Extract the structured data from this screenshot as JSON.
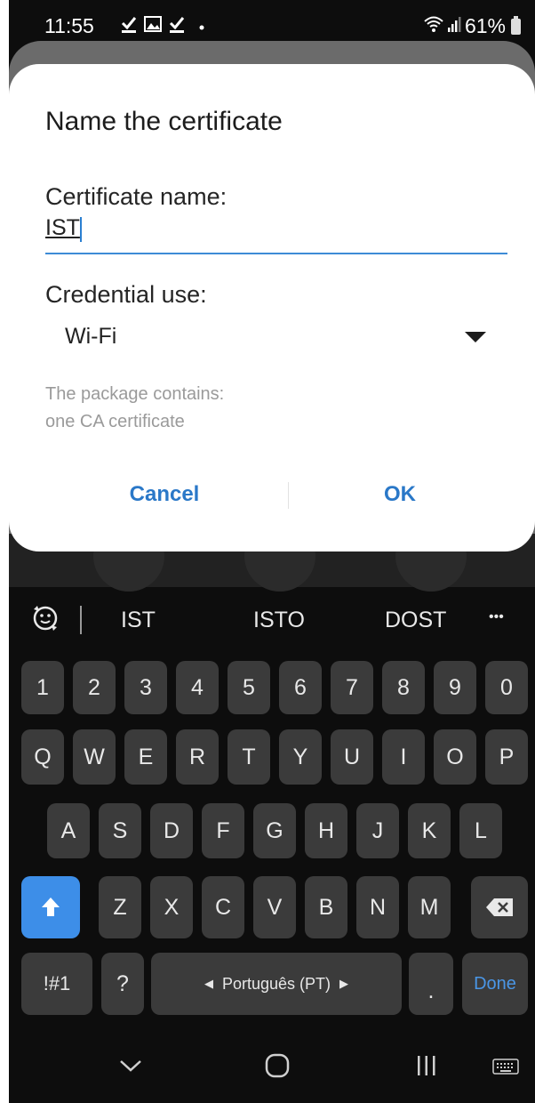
{
  "status_bar": {
    "time": "11:55",
    "notification_icons": [
      "download-done-icon",
      "image-icon",
      "download-done-icon",
      "dot-icon"
    ],
    "battery_percent": "61%",
    "signal_icons": [
      "wifi-icon",
      "signal-icon",
      "battery-icon"
    ]
  },
  "dialog": {
    "title": "Name the certificate",
    "certificate_name_label": "Certificate name:",
    "certificate_name_value": "IST",
    "credential_use_label": "Credential use:",
    "credential_use_value": "Wi-Fi",
    "info_line1": "The package contains:",
    "info_line2": "one CA certificate",
    "cancel_label": "Cancel",
    "ok_label": "OK",
    "accent_color": "#2a78c8"
  },
  "keyboard": {
    "suggestions": [
      "IST",
      "ISTO",
      "DOST"
    ],
    "more_label": "•••",
    "row_numbers": [
      "1",
      "2",
      "3",
      "4",
      "5",
      "6",
      "7",
      "8",
      "9",
      "0"
    ],
    "row_top": [
      "Q",
      "W",
      "E",
      "R",
      "T",
      "Y",
      "U",
      "I",
      "O",
      "P"
    ],
    "row_middle": [
      "A",
      "S",
      "D",
      "F",
      "G",
      "H",
      "J",
      "K",
      "L"
    ],
    "row_bottom": [
      "Z",
      "X",
      "C",
      "V",
      "B",
      "N",
      "M"
    ],
    "symbols_label": "!#1",
    "question_label": "?",
    "space_label": "Português (PT)",
    "period_label": ".",
    "done_label": "Done",
    "shift_color": "#3d8ee8"
  },
  "nav_bar": {
    "buttons": [
      "hide-keyboard-icon",
      "home-icon",
      "recents-icon",
      "keyboard-switch-icon"
    ]
  }
}
